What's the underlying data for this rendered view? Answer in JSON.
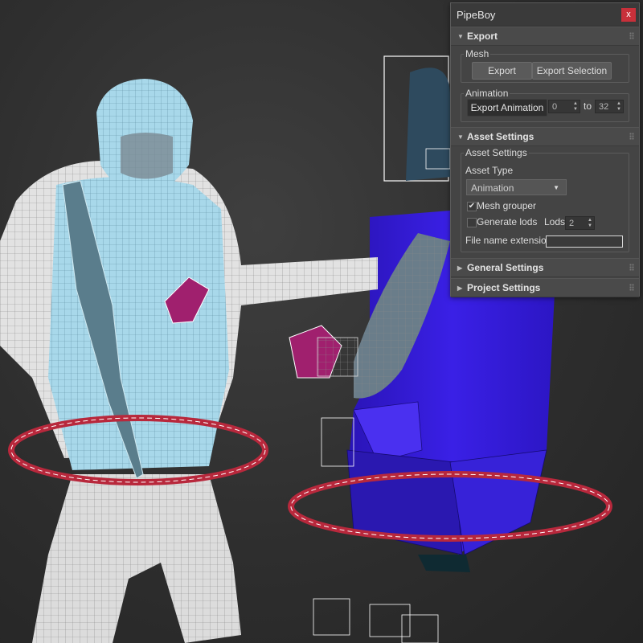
{
  "panel": {
    "title": "PipeBoy",
    "close_label": "x",
    "export": {
      "header": "Export",
      "mesh_group_label": "Mesh",
      "export_button": "Export",
      "export_selection_button": "Export Selection",
      "animation_group_label": "Animation",
      "export_animation_button": "Export Animation",
      "frame_from": "0",
      "to_label": "to",
      "frame_to": "32"
    },
    "asset_settings": {
      "header": "Asset Settings",
      "group_label": "Asset Settings",
      "asset_type_label": "Asset Type",
      "asset_type_value": "Animation",
      "mesh_grouper_label": "Mesh grouper",
      "mesh_grouper_checked": true,
      "generate_lods_label": "Generate lods",
      "generate_lods_checked": false,
      "lods_label": "Lods",
      "lods_value": "2",
      "file_name_extension_label": "File name extension",
      "file_name_extension_value": ""
    },
    "general_settings": {
      "header": "General Settings"
    },
    "project_settings": {
      "header": "Project Settings"
    }
  },
  "icons": {
    "expanded": "triangle-down",
    "collapsed": "triangle-right",
    "checkmark": "✔"
  },
  "colors": {
    "panel_bg": "#444444",
    "close_red": "#c8303a",
    "soldier_skin": "#e6e6e6",
    "vest_blue": "#a8d8ea",
    "dummy_blue": "#3c1ee0",
    "ring_red": "#b8283c",
    "hand_magenta": "#a0206e"
  }
}
